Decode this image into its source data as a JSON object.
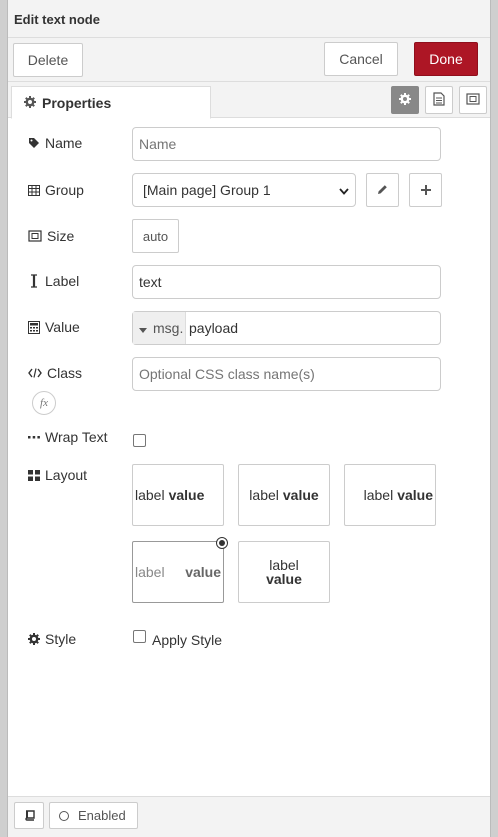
{
  "dialog": {
    "title": "Edit text node",
    "delete_label": "Delete",
    "cancel_label": "Cancel",
    "done_label": "Done",
    "accent_color": "#ad1625"
  },
  "tabs": {
    "properties_label": "Properties"
  },
  "fields": {
    "name": {
      "label": "Name",
      "placeholder": "Name",
      "value": ""
    },
    "group": {
      "label": "Group",
      "selected": "[Main page] Group 1"
    },
    "size": {
      "label": "Size",
      "value": "auto"
    },
    "label": {
      "label": "Label",
      "value": "text"
    },
    "value": {
      "label": "Value",
      "type_prefix": "msg.",
      "value": "payload"
    },
    "class": {
      "label": "Class",
      "placeholder": "Optional CSS class name(s)",
      "fx_label": "fx"
    },
    "wrap_text": {
      "label": "Wrap Text",
      "checked": false
    },
    "layout": {
      "label": "Layout",
      "options": [
        {
          "label": "label",
          "value": "value"
        },
        {
          "label": "label",
          "value": "value"
        },
        {
          "label": "label",
          "value": "value"
        },
        {
          "label": "label",
          "value": "value"
        },
        {
          "label": "label",
          "value": "value"
        }
      ],
      "selected_index": 3
    },
    "style": {
      "label": "Style",
      "checkbox_label": "Apply Style",
      "checked": false
    }
  },
  "footer": {
    "enabled_label": "Enabled"
  },
  "icons": {
    "tag": "tag-icon",
    "table": "table-icon",
    "size": "resize-icon",
    "label": "text-cursor-icon",
    "value": "calculator-icon",
    "class": "code-icon",
    "wrap": "ellipsis-icon",
    "layout": "grid-icon",
    "style": "gear-icon"
  }
}
